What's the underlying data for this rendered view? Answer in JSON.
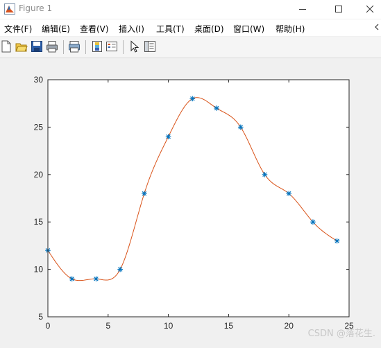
{
  "window": {
    "title": "Figure 1",
    "icon": "matlab-figure-icon",
    "controls": [
      "minimize-icon",
      "maximize-icon",
      "close-icon"
    ]
  },
  "menu": {
    "items": [
      {
        "label": "文件(F)",
        "name": "menu-file"
      },
      {
        "label": "编辑(E)",
        "name": "menu-edit"
      },
      {
        "label": "查看(V)",
        "name": "menu-view"
      },
      {
        "label": "插入(I)",
        "name": "menu-insert"
      },
      {
        "label": "工具(T)",
        "name": "menu-tools"
      },
      {
        "label": "桌面(D)",
        "name": "menu-desktop"
      },
      {
        "label": "窗口(W)",
        "name": "menu-window"
      },
      {
        "label": "帮助(H)",
        "name": "menu-help"
      }
    ],
    "overflow_icon": "menu-dock-arrow-icon"
  },
  "toolbar": {
    "tools": [
      "new-figure-icon",
      "open-file-icon",
      "save-icon",
      "print-icon",
      "print-preview-icon",
      "insert-colorbar-icon",
      "insert-legend-icon",
      "edit-plot-icon",
      "property-inspector-icon"
    ]
  },
  "chart_data": {
    "type": "line",
    "title": "",
    "xlabel": "",
    "ylabel": "",
    "xlim": [
      0,
      25
    ],
    "ylim": [
      5,
      30
    ],
    "xticks": [
      "0",
      "5",
      "10",
      "15",
      "20",
      "25"
    ],
    "yticks": [
      "5",
      "10",
      "15",
      "20",
      "25",
      "30"
    ],
    "grid": false,
    "x": [
      0,
      2,
      4,
      6,
      8,
      10,
      12,
      14,
      16,
      18,
      20,
      22,
      24
    ],
    "series": [
      {
        "values": [
          12,
          9,
          9,
          10,
          18,
          24,
          28,
          27,
          25,
          20,
          18,
          15,
          13
        ],
        "marker": "*",
        "line": "none",
        "color": "#0072BD"
      },
      {
        "style": "interpolated-curve",
        "color": "#D95319"
      }
    ]
  },
  "watermark": "CSDN @落花生."
}
